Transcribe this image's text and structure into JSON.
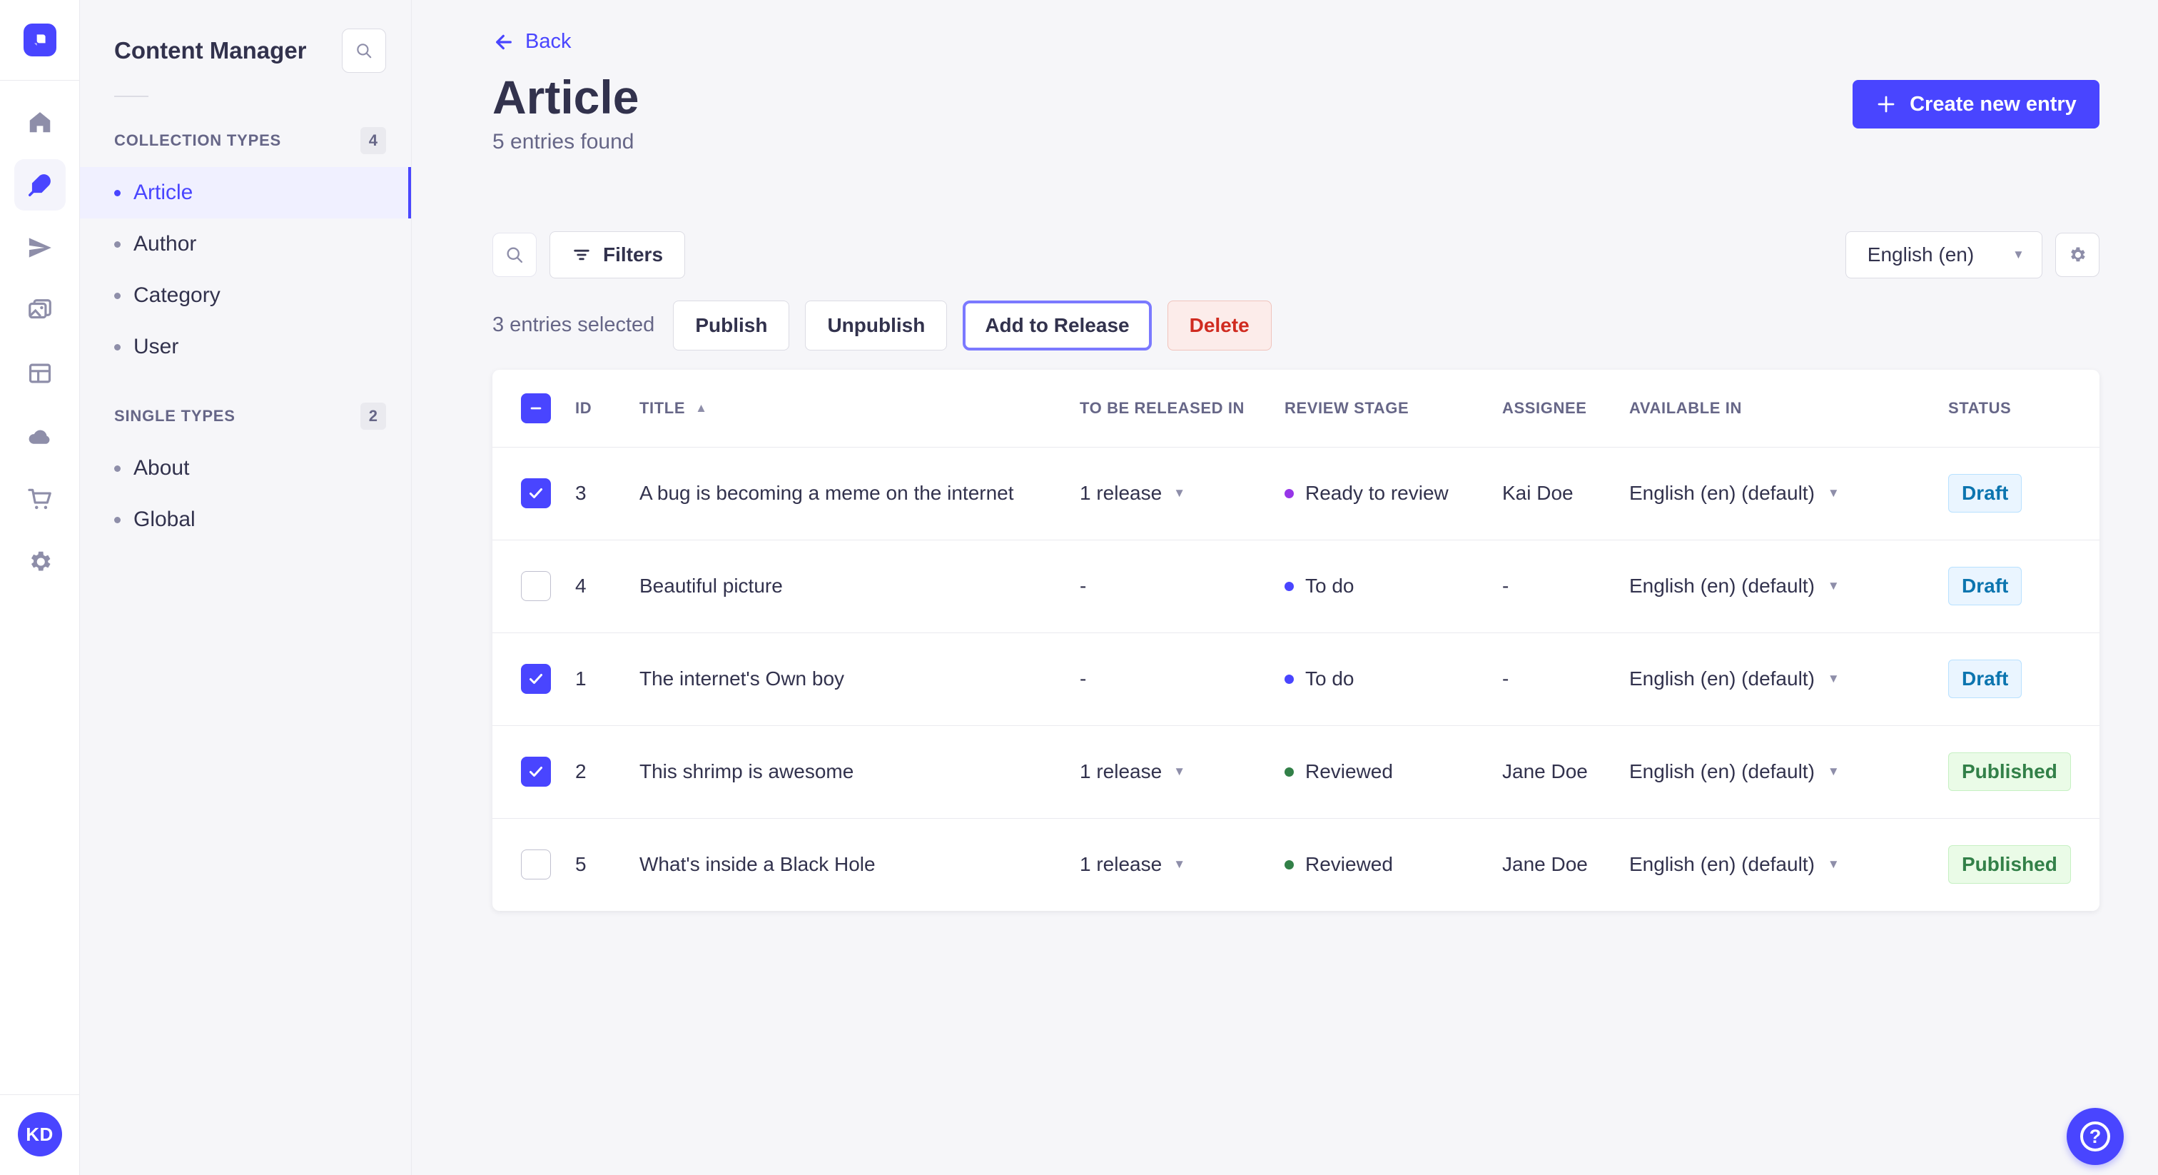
{
  "colors": {
    "accent": "#4945ff",
    "active_item_bg": "#f0f0ff",
    "draft_text": "#0c75af",
    "published_text": "#328048",
    "delete_text": "#d02b20",
    "release_focus_ring": "#7b79ff"
  },
  "rail": {
    "icons": [
      "strapi-logo",
      "home",
      "content-manager",
      "releases",
      "media-library",
      "content-type-builder",
      "cloud",
      "marketplace",
      "settings"
    ],
    "active_icon": "content-manager",
    "avatar_initials": "KD"
  },
  "subnav": {
    "title": "Content Manager",
    "sections": [
      {
        "label": "COLLECTION TYPES",
        "count": "4",
        "items": [
          {
            "label": "Article",
            "active": true
          },
          {
            "label": "Author",
            "active": false
          },
          {
            "label": "Category",
            "active": false
          },
          {
            "label": "User",
            "active": false
          }
        ]
      },
      {
        "label": "SINGLE TYPES",
        "count": "2",
        "items": [
          {
            "label": "About",
            "active": false
          },
          {
            "label": "Global",
            "active": false
          }
        ]
      }
    ]
  },
  "header": {
    "back_label": "Back",
    "title": "Article",
    "subtitle": "5 entries found",
    "create_button_label": "Create new entry"
  },
  "toolbar": {
    "filters_label": "Filters",
    "locale_value": "English (en)"
  },
  "selection": {
    "text": "3 entries selected",
    "publish_label": "Publish",
    "unpublish_label": "Unpublish",
    "add_to_release_label": "Add to Release",
    "delete_label": "Delete"
  },
  "table": {
    "columns": [
      "ID",
      "TITLE",
      "TO BE RELEASED IN",
      "REVIEW STAGE",
      "ASSIGNEE",
      "AVAILABLE IN",
      "STATUS"
    ],
    "sort_column": "TITLE",
    "sort_direction": "asc",
    "header_checkbox_state": "indeterminate",
    "rows": [
      {
        "checked": true,
        "id": "3",
        "title": "A bug is becoming a meme on the internet",
        "release": "1 release",
        "has_release": true,
        "stage": "Ready to review",
        "stage_color": "#9736e8",
        "assignee": "Kai Doe",
        "locale": "English (en) (default)",
        "status": "Draft",
        "status_variant": "draft"
      },
      {
        "checked": false,
        "id": "4",
        "title": "Beautiful picture",
        "release": "-",
        "has_release": false,
        "stage": "To do",
        "stage_color": "#4945ff",
        "assignee": "-",
        "locale": "English (en) (default)",
        "status": "Draft",
        "status_variant": "draft"
      },
      {
        "checked": true,
        "id": "1",
        "title": "The internet's Own boy",
        "release": "-",
        "has_release": false,
        "stage": "To do",
        "stage_color": "#4945ff",
        "assignee": "-",
        "locale": "English (en) (default)",
        "status": "Draft",
        "status_variant": "draft"
      },
      {
        "checked": true,
        "id": "2",
        "title": "This shrimp is awesome",
        "release": "1 release",
        "has_release": true,
        "stage": "Reviewed",
        "stage_color": "#328048",
        "assignee": "Jane Doe",
        "locale": "English (en) (default)",
        "status": "Published",
        "status_variant": "published"
      },
      {
        "checked": false,
        "id": "5",
        "title": "What's inside a Black Hole",
        "release": "1 release",
        "has_release": true,
        "stage": "Reviewed",
        "stage_color": "#328048",
        "assignee": "Jane Doe",
        "locale": "English (en) (default)",
        "status": "Published",
        "status_variant": "published"
      }
    ]
  },
  "help": {
    "label": "?"
  }
}
